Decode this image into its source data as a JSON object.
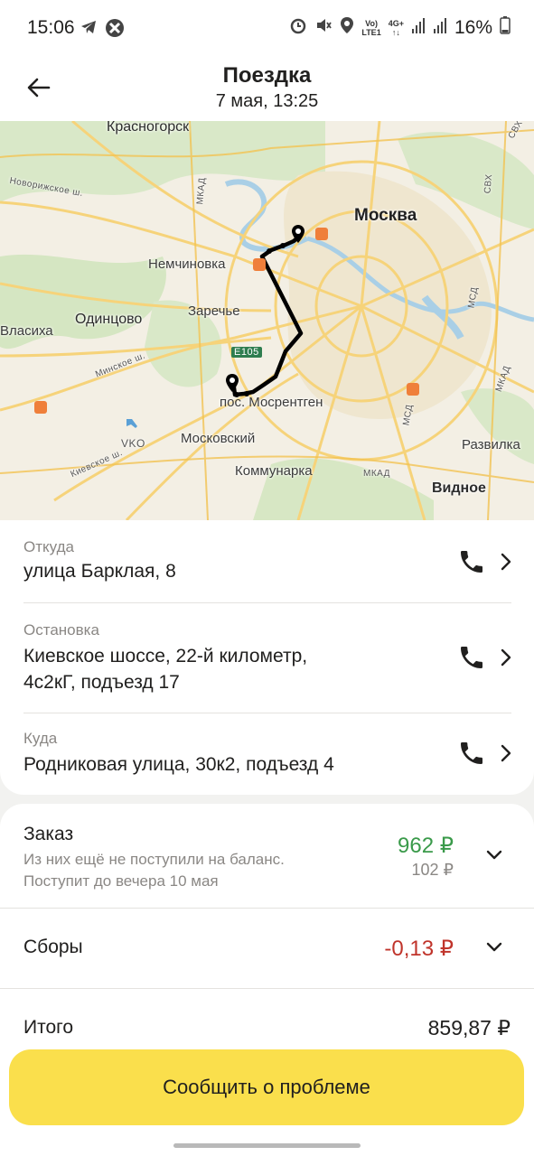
{
  "status_bar": {
    "time": "15:06",
    "left_icons": [
      "telegram-icon",
      "app-icon"
    ],
    "right_icons": [
      "alarm-icon",
      "mute-icon",
      "location-icon",
      "volte-icon",
      "4g-icon",
      "signal-icon",
      "signal-icon"
    ],
    "network_top": "Vo)",
    "network_bottom": "LTE1",
    "net4g_top": "4G+",
    "battery": "16%"
  },
  "header": {
    "title": "Поездка",
    "subtitle": "7 мая, 13:25"
  },
  "map": {
    "labels": {
      "krasnogorsk": "Красногорск",
      "moskva": "Москва",
      "nemchinovka": "Немчиновка",
      "odintsovo": "Одинцово",
      "zarechye": "Заречье",
      "vlasikha": "Власиха",
      "mosrentgen": "пос. Мосрентген",
      "moskovsky": "Московский",
      "kommunarka": "Коммунарка",
      "vidnoe": "Видное",
      "razvilka": "Развилка",
      "vko": "VKO",
      "e105": "E105",
      "novorizhskoe": "Новорижское ш.",
      "minskoe": "Минское ш.",
      "kievskoe": "Киевское ш.",
      "mkad": "МКАД",
      "mkad2": "МКАД",
      "mkad3": "МКАД",
      "mcd": "МСД",
      "mcd2": "МСД",
      "svh": "СВХ",
      "svh2": "СВХ"
    },
    "colors": {
      "land": "#f3efe4",
      "green": "#cfe3bc",
      "water": "#a9cfe6",
      "road": "#f6d37a",
      "route": "#000000"
    }
  },
  "route": {
    "from": {
      "caption": "Откуда",
      "address": "улица Барклая, 8"
    },
    "stop": {
      "caption": "Остановка",
      "address_line1": "Киевское шоссе, 22-й километр,",
      "address_line2": "4с2кГ, подъезд 17"
    },
    "to": {
      "caption": "Куда",
      "address": "Родниковая улица, 30к2, подъезд 4"
    }
  },
  "order": {
    "title": "Заказ",
    "note_line1": "Из них ещё не поступили на баланс.",
    "note_line2": "Поступит до вечера 10 мая",
    "amount": "962 ₽",
    "pending": "102 ₽",
    "fees_title": "Сборы",
    "fees_amount": "-0,13 ₽",
    "total_title": "Итого",
    "total_amount": "859,87 ₽"
  },
  "actions": {
    "report_label": "Сообщить о проблеме"
  }
}
